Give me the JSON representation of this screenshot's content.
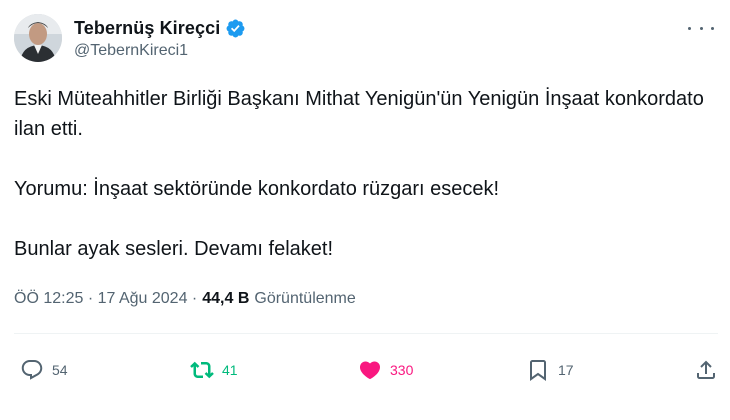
{
  "user": {
    "display_name": "Tebernüş Kireçci",
    "handle": "@TebernKireci1",
    "verified": true
  },
  "icons": {
    "avatar": "avatar-photo",
    "verified": "verified-badge-icon",
    "more": "more-options-icon",
    "reply": "reply-icon",
    "retweet": "retweet-icon",
    "like": "heart-icon",
    "bookmark": "bookmark-icon",
    "share": "share-icon"
  },
  "tweet": {
    "paragraphs": [
      "Eski Müteahhitler Birliği Başkanı Mithat Yenigün'ün Yenigün İnşaat konkordato ilan etti.",
      "Yorumu: İnşaat sektöründe konkordato rüzgarı esecek!",
      "Bunlar ayak sesleri. Devamı felaket!"
    ]
  },
  "meta": {
    "time_date": "ÖÖ 12:25 · 17 Ağu 2024 ·",
    "views_count": "44,4 B",
    "views_label": "Görüntülenme"
  },
  "actions": {
    "replies": "54",
    "retweets": "41",
    "likes": "330",
    "bookmarks": "17"
  },
  "colors": {
    "text_primary": "#0f1419",
    "text_secondary": "#536471",
    "verified": "#1d9bf0",
    "retweet_active": "#00ba7c",
    "like_active": "#f91880",
    "divider": "#eff3f4"
  }
}
